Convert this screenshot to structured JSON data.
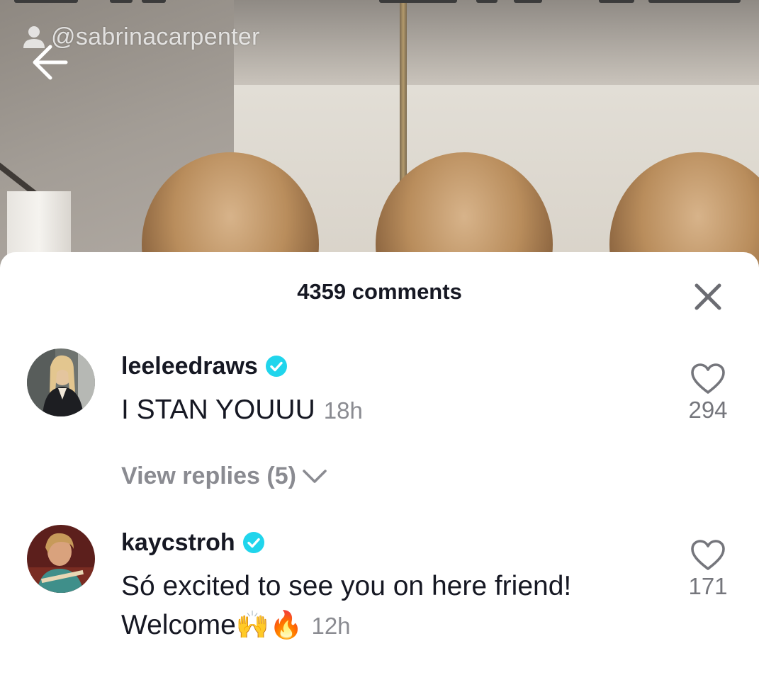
{
  "video": {
    "author_handle": "@sabrinacarpenter"
  },
  "comments_sheet": {
    "title": "4359 comments",
    "comments": [
      {
        "username": "leeleedraws",
        "verified": true,
        "text": "I STAN YOUUU",
        "time": "18h",
        "likes": "294",
        "view_replies_label": "View replies (5)"
      },
      {
        "username": "kaycstroh",
        "verified": true,
        "text": "Só excited to see you on here friend! Welcome",
        "emoji": "🙌🔥",
        "time": "12h",
        "likes": "171"
      }
    ]
  },
  "colors": {
    "text_primary": "#161823",
    "text_secondary": "#8a8b91",
    "verified_badge": "#20d5ec",
    "sheet_background": "#ffffff"
  },
  "icons": [
    "person-icon",
    "back-arrow-icon",
    "close-icon",
    "verified-icon",
    "heart-icon",
    "chevron-down-icon"
  ]
}
